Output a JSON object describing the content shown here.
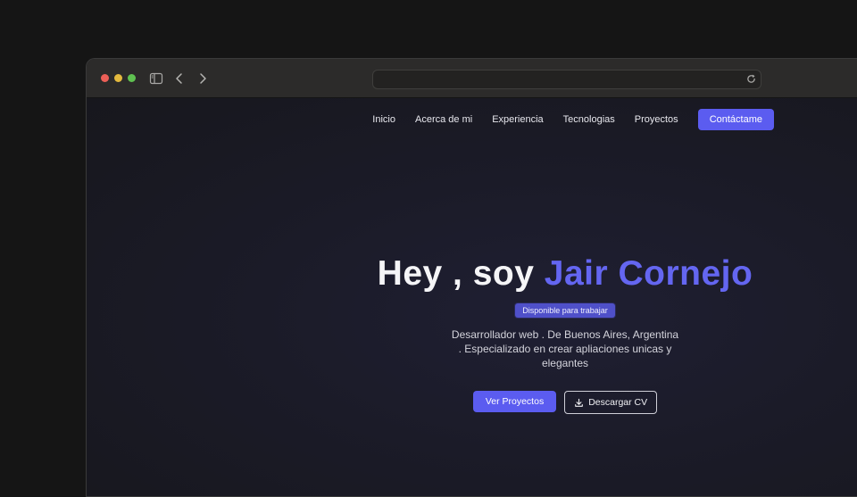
{
  "browser": {
    "controls": [
      "close",
      "minimize",
      "maximize"
    ],
    "icons": [
      "sidebar-icon",
      "back-arrow-icon",
      "forward-arrow-icon",
      "reload-icon"
    ],
    "url": ""
  },
  "nav": {
    "links": [
      "Inicio",
      "Acerca de mi",
      "Experiencia",
      "Tecnologias",
      "Proyectos"
    ],
    "cta": "Contáctame"
  },
  "hero": {
    "title_prefix": "Hey , soy ",
    "title_name": "Jair Cornejo",
    "badge": "Disponible para trabajar",
    "description": "Desarrollador web . De Buenos Aires, Argentina . Especializado en crear apliaciones unicas y elegantes",
    "primary_button": "Ver Proyectos",
    "secondary_button": "Descargar CV",
    "secondary_icon": "download-icon"
  },
  "colors": {
    "accent": "#5b5cf0",
    "background": "#1b1b28",
    "titlebar": "#2c2b2a"
  }
}
